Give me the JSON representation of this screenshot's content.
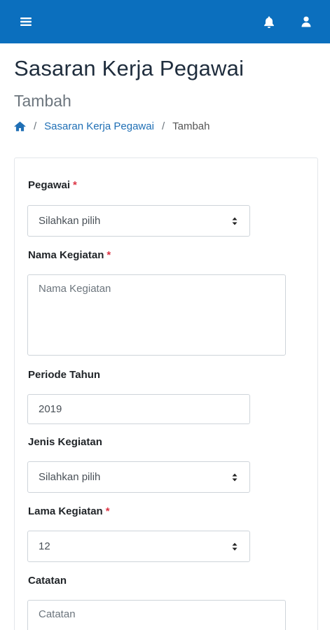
{
  "navbar": {
    "background": "#0b6fbe",
    "menu_icon": "hamburger-menu-icon",
    "notification_icon": "bell-icon",
    "user_icon": "user-icon"
  },
  "page": {
    "title": "Sasaran Kerja Pegawai",
    "subtitle": "Tambah"
  },
  "breadcrumb": {
    "home_icon": "home-icon",
    "separator": "/",
    "items": [
      "Sasaran Kerja Pegawai",
      "Tambah"
    ]
  },
  "form": {
    "required_mark": "*",
    "pegawai": {
      "label": "Pegawai",
      "value": "Silahkan pilih"
    },
    "nama_kegiatan": {
      "label": "Nama Kegiatan",
      "placeholder": "Nama Kegiatan"
    },
    "periode_tahun": {
      "label": "Periode Tahun",
      "value": "2019"
    },
    "jenis_kegiatan": {
      "label": "Jenis Kegiatan",
      "value": "Silahkan pilih"
    },
    "lama_kegiatan": {
      "label": "Lama Kegiatan",
      "value": "12"
    },
    "catatan": {
      "label": "Catatan",
      "placeholder": "Catatan"
    }
  }
}
